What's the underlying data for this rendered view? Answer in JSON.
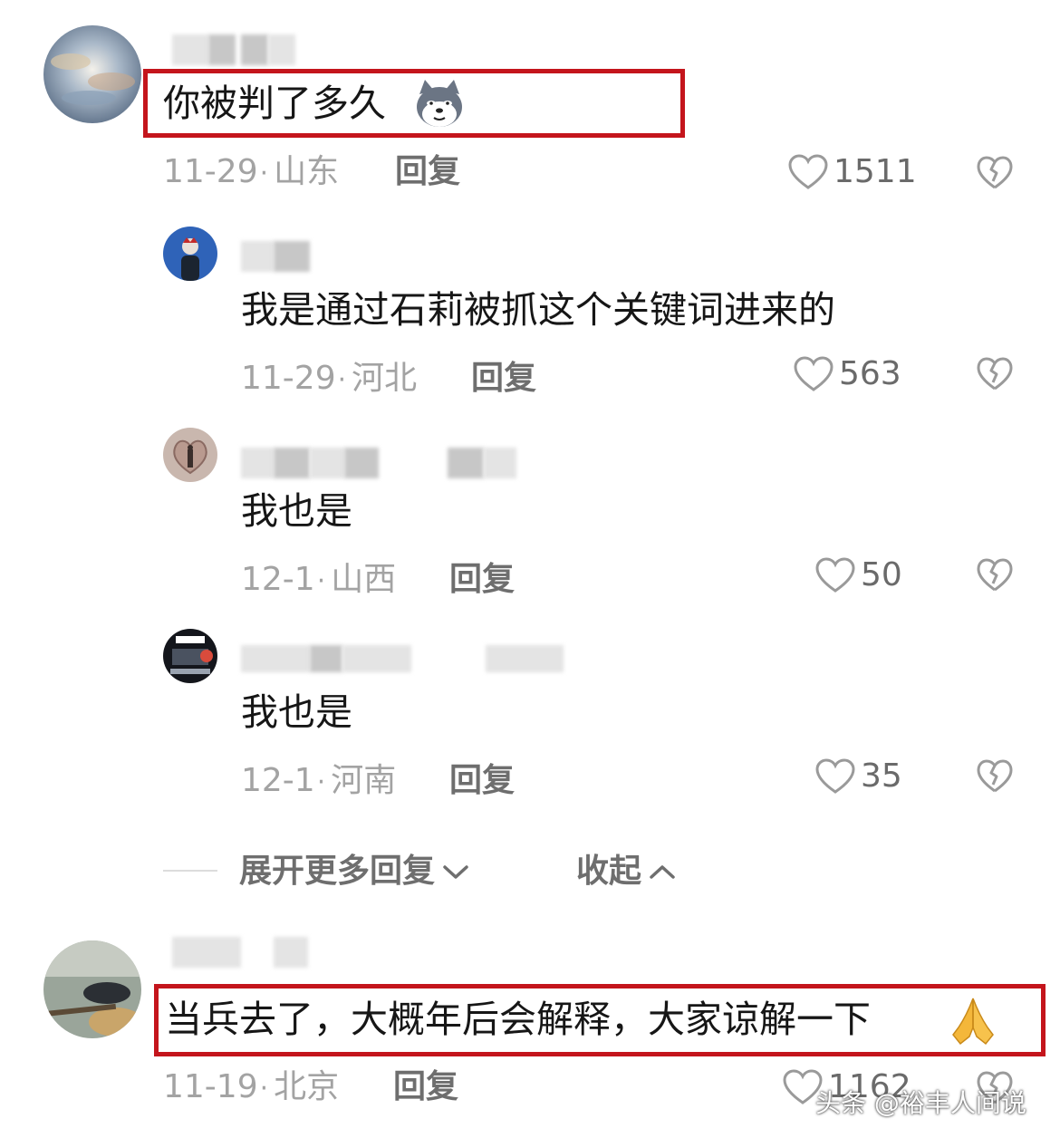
{
  "comments": [
    {
      "text": "你被判了多久",
      "emoji_icon": "doge-icon",
      "date": "11-29",
      "location": "山东",
      "reply_label": "回复",
      "likes": "1511"
    },
    {
      "text": "当兵去了，大概年后会解释，大家谅解一下",
      "emoji_icon": "folded-hands-icon",
      "date": "11-19",
      "location": "北京",
      "reply_label": "回复",
      "likes": "1162"
    }
  ],
  "replies": [
    {
      "text": "我是通过石莉被抓这个关键词进来的",
      "date": "11-29",
      "location": "河北",
      "reply_label": "回复",
      "likes": "563"
    },
    {
      "text": "我也是",
      "date": "12-1",
      "location": "山西",
      "reply_label": "回复",
      "likes": "50"
    },
    {
      "text": "我也是",
      "date": "12-1",
      "location": "河南",
      "reply_label": "回复",
      "likes": "35"
    }
  ],
  "thread_controls": {
    "expand_label": "展开更多回复",
    "collapse_label": "收起"
  },
  "separator": "·",
  "watermark": "头条 @裕丰人间说",
  "colors": {
    "highlight_border": "#c4151c",
    "meta_text": "#a3a3a3",
    "action_text": "#6e6e6e"
  }
}
